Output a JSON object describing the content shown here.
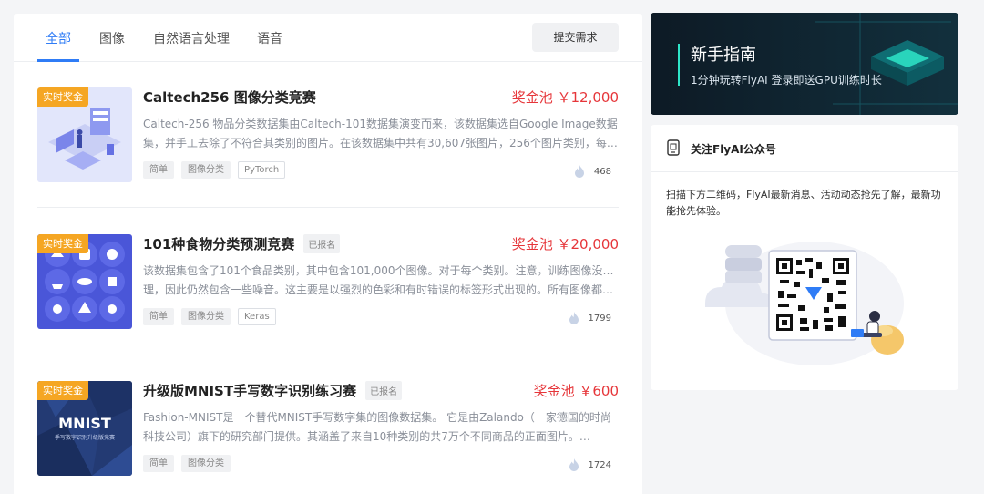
{
  "tabs": [
    {
      "label": "全部",
      "active": true
    },
    {
      "label": "图像",
      "active": false
    },
    {
      "label": "自然语言处理",
      "active": false
    },
    {
      "label": "语音",
      "active": false
    }
  ],
  "submit_label": "提交需求",
  "competitions": [
    {
      "badge": "实时奖金",
      "title": "Caltech256 图像分类竞赛",
      "enrolled": "",
      "prize": "奖金池 ￥12,000",
      "desc_line1": "Caltech-256 物品分类数据集由Caltech-101数据集演变而来，该数据集选自Google Image数据",
      "desc_line2": "集，并手工去除了不符合其类别的图片。在该数据集中共有30,607张图片，256个图片类别，每…",
      "tags": [
        "简单",
        "图像分类",
        "PyTorch"
      ],
      "hot": "468",
      "thumb_icon": "isometric-lab-icon"
    },
    {
      "badge": "实时奖金",
      "title": "101种食物分类预测竞赛",
      "enrolled": "已报名",
      "prize": "奖金池 ￥20,000",
      "desc_line1": "该数据集包含了101个食品类别，其中包含101,000个图像。对于每个类别。注意，训练图像没有清",
      "desc_line2": "理，因此仍然包含一些噪音。这主要是以强烈的色彩和有时错误的标签形式出现的。所有图像都…",
      "tags": [
        "简单",
        "图像分类",
        "Keras"
      ],
      "hot": "1799",
      "thumb_icon": "food-icons-icon"
    },
    {
      "badge": "实时奖金",
      "title": "升级版MNIST手写数字识别练习赛",
      "enrolled": "已报名",
      "prize": "奖金池 ￥600",
      "desc_line1": "Fashion-MNIST是一个替代MNIST手写数字集的图像数据集。 它是由Zalando（一家德国的时尚",
      "desc_line2": "科技公司）旗下的研究部门提供。其涵盖了来自10种类别的共7万个不同商品的正面图片。…",
      "tags": [
        "简单",
        "图像分类"
      ],
      "hot": "1724",
      "thumb_text": "MNIST",
      "thumb_sub": "手写数字识别升级版竞赛"
    }
  ],
  "banner": {
    "title": "新手指南",
    "subtitle": "1分钟玩转FlyAI 登录即送GPU训练时长"
  },
  "wechat": {
    "title": "关注FlyAI公众号",
    "desc": "扫描下方二维码，FlyAI最新消息、活动动态抢先了解，最新功能抢先体验。"
  },
  "colors": {
    "accent": "#2f7cf6",
    "prize": "#e6363a",
    "badge": "#f5a623"
  }
}
